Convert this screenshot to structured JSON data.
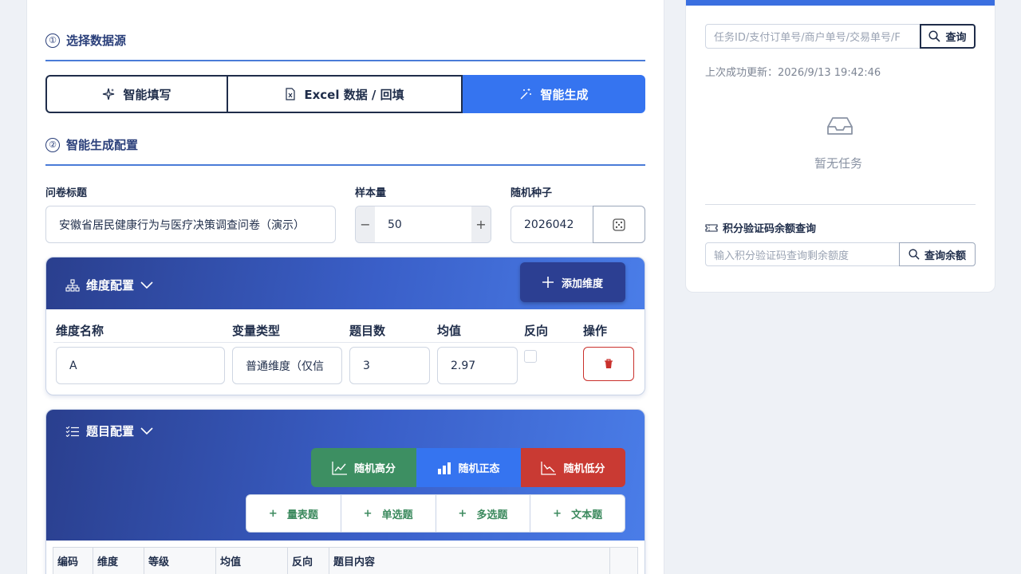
{
  "source_section": {
    "number": "①",
    "title": "选择数据源",
    "tabs": [
      {
        "label": "智能填写",
        "icon": "sparkle-icon"
      },
      {
        "label": "Excel 数据 / 回填",
        "icon": "excel-file-icon"
      },
      {
        "label": "智能生成",
        "icon": "magic-wand-icon",
        "active": true
      }
    ]
  },
  "config_section": {
    "number": "②",
    "title": "智能生成配置",
    "questionnaire_title_label": "问卷标题",
    "questionnaire_title_value": "安徽省居民健康行为与医疗决策调查问卷（演示）",
    "sample_size_label": "样本量",
    "sample_size_value": "50",
    "stepper_minus": "−",
    "stepper_plus": "+",
    "random_seed_label": "随机种子",
    "random_seed_value": "2026042"
  },
  "dimension_panel": {
    "title": "维度配置",
    "add_button": "添加维度",
    "headers": [
      "维度名称",
      "变量类型",
      "题目数",
      "均值",
      "反向",
      "操作"
    ],
    "rows": [
      {
        "name": "A",
        "type": "普通维度（仅信",
        "count": "3",
        "mean": "2.97"
      }
    ]
  },
  "question_panel": {
    "title": "题目配置",
    "random_buttons": [
      {
        "label": "随机高分",
        "color": "#3d8f62"
      },
      {
        "label": "随机正态",
        "color": "#3574f0"
      },
      {
        "label": "随机低分",
        "color": "#c93a33"
      }
    ],
    "add_buttons": [
      "量表题",
      "单选题",
      "多选题",
      "文本题"
    ],
    "table_headers": [
      "编码",
      "维度",
      "等级",
      "均值",
      "反向",
      "题目内容"
    ]
  },
  "side_panel": {
    "task_search_placeholder": "任务ID/支付订单号/商户单号/交易单号/F",
    "task_query_button": "查询",
    "last_update": "上次成功更新：2026/9/13 19:42:46",
    "empty_text": "暂无任务",
    "balance_title": "积分验证码余额查询",
    "balance_placeholder": "输入积分验证码查询剩余额度",
    "balance_button": "查询余额"
  },
  "colors": {
    "accent_blue": "#3574f0",
    "navy": "#1f2d4a",
    "high_green": "#3d8f62",
    "low_red": "#c93a33"
  }
}
